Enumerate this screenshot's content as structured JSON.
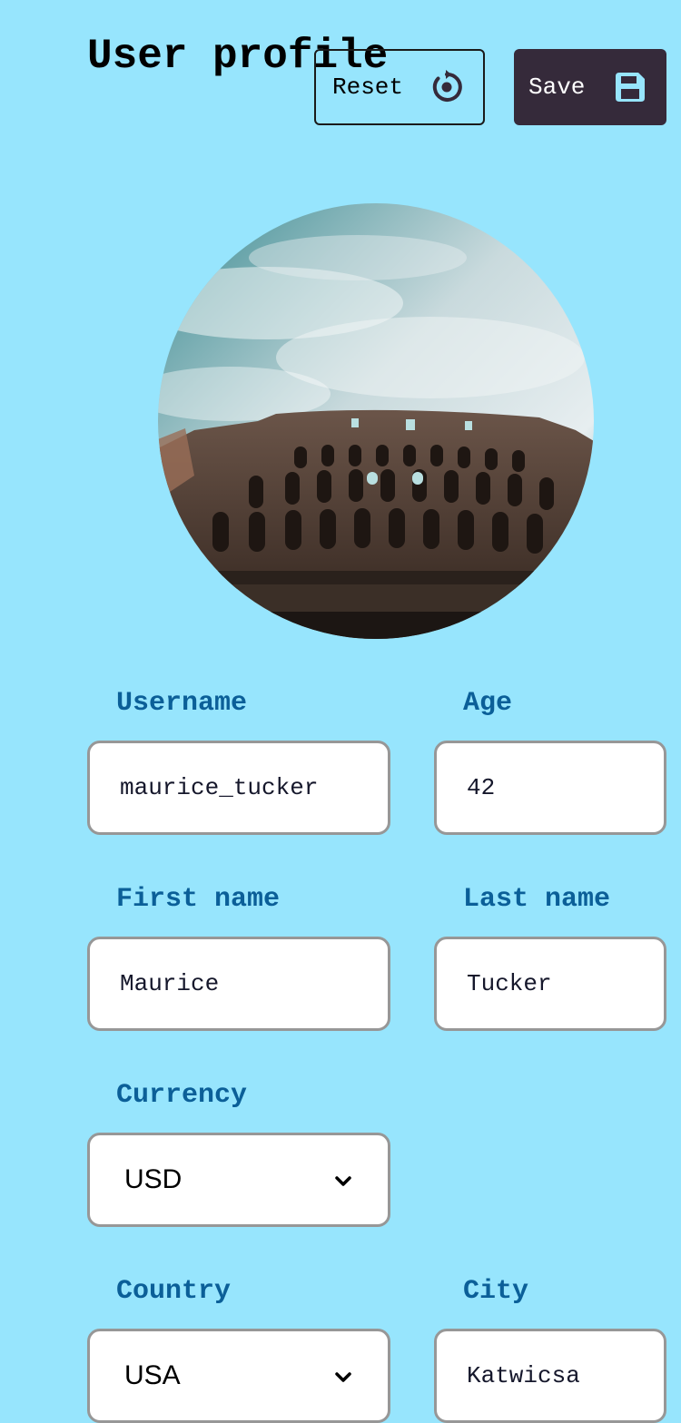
{
  "header": {
    "title": "User profile",
    "reset_label": "Reset",
    "save_label": "Save"
  },
  "form": {
    "username": {
      "label": "Username",
      "value": "maurice_tucker"
    },
    "age": {
      "label": "Age",
      "value": "42"
    },
    "first_name": {
      "label": "First name",
      "value": "Maurice"
    },
    "last_name": {
      "label": "Last name",
      "value": "Tucker"
    },
    "currency": {
      "label": "Currency",
      "value": "USD"
    },
    "country": {
      "label": "Country",
      "value": "USA"
    },
    "city": {
      "label": "City",
      "value": "Katwicsa"
    }
  },
  "icons": {
    "reset": "reset-icon",
    "save": "floppy-disk-icon",
    "dropdown": "chevron-down-icon"
  },
  "colors": {
    "background": "#97e5fd",
    "label": "#0b5f98",
    "save_button": "#352a3a",
    "save_icon": "#97e5fd",
    "field_border": "#979797"
  }
}
